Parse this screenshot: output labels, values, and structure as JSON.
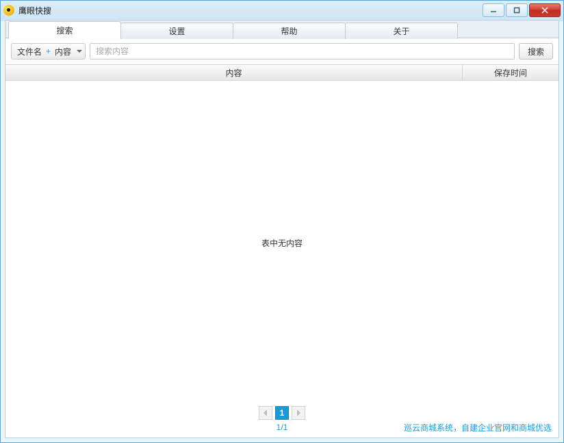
{
  "window": {
    "title": "鹰眼快搜"
  },
  "tabs": [
    {
      "label": "搜索",
      "active": true
    },
    {
      "label": "设置",
      "active": false
    },
    {
      "label": "帮助",
      "active": false
    },
    {
      "label": "关于",
      "active": false
    }
  ],
  "search": {
    "dropdown_prefix": "文件名",
    "dropdown_plus": "+",
    "dropdown_suffix": "内容",
    "placeholder": "搜索内容",
    "button_label": "搜索"
  },
  "table": {
    "columns": {
      "content": "内容",
      "save_time": "保存时间"
    },
    "empty_message": "表中无内容",
    "rows": []
  },
  "pagination": {
    "current": "1",
    "display": "1/1"
  },
  "footer": {
    "promo_text": "巡云商城系统，自建企业官网和商城优选"
  }
}
